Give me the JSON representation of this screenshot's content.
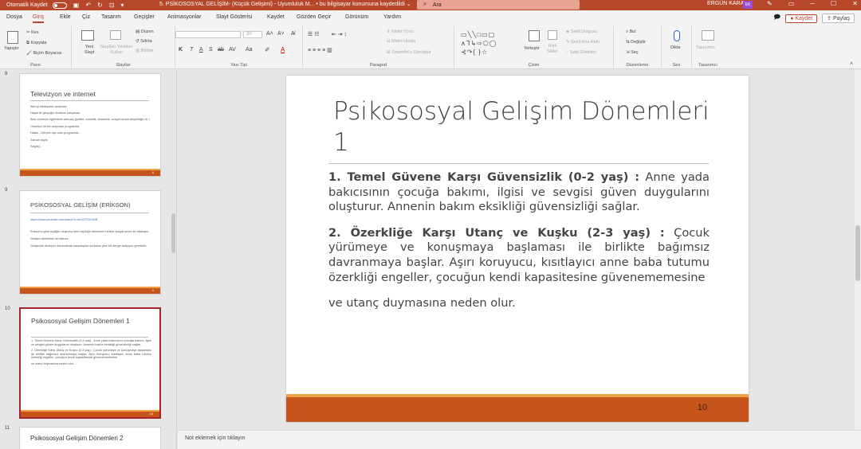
{
  "titlebar": {
    "autosave": "Otomatik Kaydet",
    "title": "5. PSİKOSOSYAL GELİŞİM- (Küçük Gelişimi) - Uyumluluk M... • bu bilgisayar konumuna kaydedildi ⌄",
    "search_placeholder": "Ara",
    "user": "ERGÜN KARA",
    "avatar": "EK",
    "icons": [
      "save-icon",
      "undo-icon",
      "redo-icon",
      "start-icon"
    ]
  },
  "menu": {
    "tabs": [
      "Dosya",
      "Giriş",
      "Ekle",
      "Çiz",
      "Tasarım",
      "Geçişler",
      "Animasyonlar",
      "Slayt Gösterisi",
      "Kaydet",
      "Gözden Geçir",
      "Görünüm",
      "Yardım"
    ],
    "active": "Giriş",
    "record": "Kaydet",
    "share": "Paylaş"
  },
  "ribbon": {
    "pano": {
      "label": "Pano",
      "paste": "Yapıştır",
      "cut": "Kes",
      "copy": "Kopyala",
      "format_painter": "Biçim Boyacısı"
    },
    "slaytlar": {
      "label": "Slaytlar",
      "new_slide": "Yeni Slayt",
      "reuse": "Slaytları Yeniden Kullan",
      "layout": "Düzen",
      "reset": "Sıfırla",
      "section": "Bölüm"
    },
    "yazi_tipi": {
      "label": "Yazı Tipi",
      "size": "20",
      "letters": [
        "K",
        "T",
        "A",
        "S",
        "ab",
        "AV",
        "Aa"
      ]
    },
    "paragraf": {
      "label": "Paragraf",
      "direction": "Metin Yönü",
      "align": "Metni Hizala",
      "smartart": "SmartArt'a Dönüştür"
    },
    "cizim": {
      "label": "Çizim",
      "arrange": "Yerleştir",
      "quick_styles": "Hızlı Stiller",
      "fill": "Şekil Dolgusu",
      "outline": "Şekil Ana Hattı",
      "effects": "Şekil Efektleri"
    },
    "duzenleme": {
      "label": "Düzenleme",
      "find": "Bul",
      "replace": "Değiştir",
      "select": "Seç"
    },
    "ses": {
      "label": "Ses",
      "dictate": "Dikte"
    },
    "tasarimci": {
      "label": "Tasarımcı",
      "designer": "Tasarımcı"
    }
  },
  "thumbnails": [
    {
      "num": "8",
      "title": "Televizyon ve internet",
      "lines": [
        "Aile içi etkileşimin azalması",
        "Hayal ile gerçeğin birbirine karışması",
        "Bazı olumsuz eğilimlerin artması (şiddet, cinsellik, tembellik, sosyal beceri düşüklüğü vb.)",
        "Olumsuz örnek oluşturan programlar",
        "Hatalı - Gerçek dışı olan programlar...",
        "Zaman kaybı",
        "Sağlık(..."
      ],
      "num_label": "8"
    },
    {
      "num": "9",
      "title": "PSİKOSOSYAL GELİŞİM (ERİKSON)",
      "link": "https://www.youtube.com/watch?v=kkOUTOhOBB",
      "lines": [
        "Erikson'a göre kişiliğin oluşumu hem biyolojik etkenlerle birlikte sosyal çevre ile etkileşim",
        "Gelişim dönemleri ile bitmez",
        "Gelişimde ilerleyen dönemlerde karşılaşılan zorluklar yeni bir denge arayışını gerektirir."
      ],
      "num_label": "9"
    },
    {
      "num": "10",
      "title": "Psikososyal Gelişim Dönemleri 1",
      "lines": [
        "1. Temel Güvene Karşı Güvensizlik (0-2 yaş) : Anne yada bakıcısının çocuğa bakımı, ilgisi ve sevgisi güven duygularını oluşturur. Annenin bakım eksikliği güvensizliği sağlar.",
        "2. Özerkliğe Karşı Utanç ve Kuşku (2-3 yaş) : Çocuk yürümeye ve konuşmaya başlaması ile birlikte bağımsız davranmaya başlar. Aşırı koruyucu, kısıtlayıcı anne baba tutumu özerkliği engeller, çocuğun kendi kapasitesine güvenememesine",
        "ve utanç duymasına neden olur."
      ],
      "num_label": "10"
    },
    {
      "num": "11",
      "title": "Psikososyal Gelişim Dönemleri 2"
    }
  ],
  "slide": {
    "title": "Psikososyal Gelişim Dönemleri 1",
    "p1_bold": "1. Temel Güvene Karşı Güvensizlik (0-2 yaş) :",
    "p1_text": " Anne yada bakıcısının çocuğa bakımı, ilgisi ve sevgisi güven duygularını oluşturur. Annenin bakım eksikliği güvensizliği sağlar.",
    "p2_bold": "2. Özerkliğe Karşı Utanç ve Kuşku (2-3 yaş) :",
    "p2_text": " Çocuk yürümeye ve konuşmaya başlaması ile birlikte bağımsız davranmaya başlar. Aşırı koruyucu, kısıtlayıcı anne baba tutumu özerkliği engeller, çocuğun kendi kapasitesine güvenememesine",
    "p3_text": "ve utanç duymasına neden olur.",
    "number": "10"
  },
  "notes": {
    "placeholder": "Not eklemek için tıklayın"
  },
  "colors": {
    "accent": "#b7472a",
    "bar": "#c5551b",
    "bar_top": "#f0a346"
  }
}
